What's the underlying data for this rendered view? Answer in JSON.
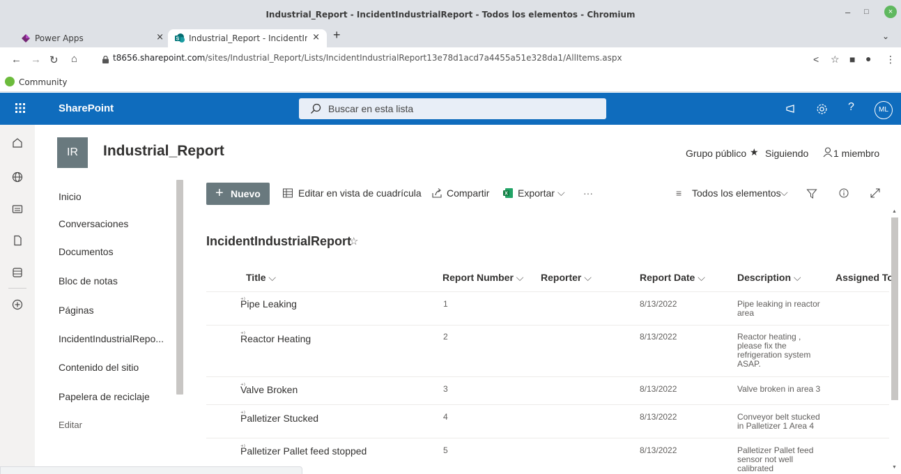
{
  "window": {
    "title": "Industrial_Report - IncidentIndustrialReport - Todos los elementos - Chromium",
    "minimize": "–",
    "maximize": "□",
    "close": "×"
  },
  "tabs": [
    {
      "label": "Power Apps",
      "close": "×"
    },
    {
      "label": "Industrial_Report - IncidentIndustrialReport",
      "close": "×"
    }
  ],
  "new_tab": "+",
  "tab_menu": "⌄",
  "address": {
    "host": "t8656.sharepoint.com",
    "path": "/sites/Industrial_Report/Lists/IncidentIndustrialReport13e78d1acd7a4455a51e328da1/AllItems.aspx"
  },
  "bookmarks": [
    {
      "label": "Community"
    }
  ],
  "suite": {
    "brand": "SharePoint",
    "search_placeholder": "Buscar en esta lista",
    "help": "?",
    "avatar": "ML"
  },
  "site": {
    "logo": "IR",
    "title": "Industrial_Report",
    "group": "Grupo público",
    "following": "Siguiendo",
    "members": "1 miembro"
  },
  "nav": {
    "items": [
      {
        "label": "Inicio"
      },
      {
        "label": "Conversaciones"
      },
      {
        "label": "Documentos"
      },
      {
        "label": "Bloc de notas"
      },
      {
        "label": "Páginas"
      },
      {
        "label": "IncidentIndustrialRepo..."
      },
      {
        "label": "Contenido del sitio"
      },
      {
        "label": "Papelera de reciclaje"
      }
    ],
    "edit": "Editar"
  },
  "commands": {
    "new": "Nuevo",
    "grid": "Editar en vista de cuadrícula",
    "share": "Compartir",
    "export": "Exportar",
    "more": "···",
    "view": "Todos los elementos"
  },
  "list": {
    "title": "IncidentIndustrialReport",
    "columns": [
      "Title",
      "Report Number",
      "Reporter",
      "Report Date",
      "Description",
      "Assigned To"
    ],
    "rows": [
      {
        "title": "Pipe Leaking",
        "number": "1",
        "date": "8/13/2022",
        "description": "Pipe leaking in reactor area"
      },
      {
        "title": "Reactor Heating",
        "number": "2",
        "date": "8/13/2022",
        "description": "Reactor heating , please fix the refrigeration system ASAP."
      },
      {
        "title": "Valve Broken",
        "number": "3",
        "date": "8/13/2022",
        "description": "Valve broken in area 3"
      },
      {
        "title": "Palletizer Stucked",
        "number": "4",
        "date": "8/13/2022",
        "description": "Conveyor belt stucked in Palletizer 1 Area 4"
      },
      {
        "title": "Palletizer Pallet feed stopped",
        "number": "5",
        "date": "8/13/2022",
        "description": "Palletizer Pallet feed sensor not well calibrated"
      }
    ]
  },
  "colors": {
    "suite_bar": "#0f6cbd",
    "site_logo": "#69797e",
    "new_button": "#69797e"
  }
}
